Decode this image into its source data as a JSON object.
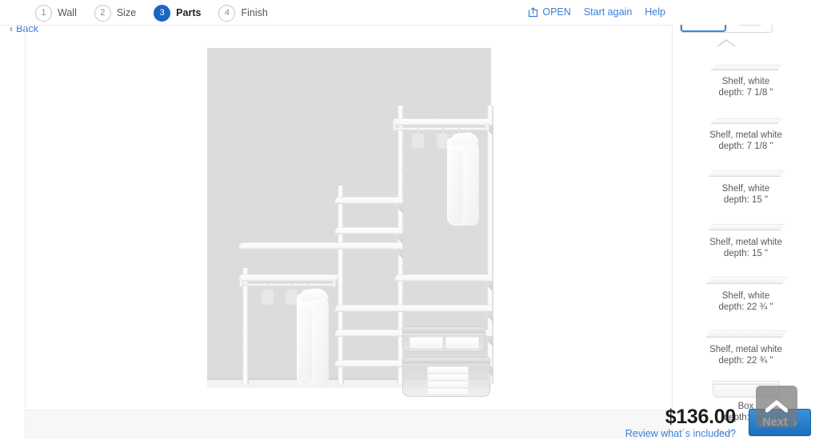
{
  "steps": [
    {
      "number": "1",
      "label": "Wall",
      "active": false
    },
    {
      "number": "2",
      "label": "Size",
      "active": false
    },
    {
      "number": "3",
      "label": "Parts",
      "active": true
    },
    {
      "number": "4",
      "label": "Finish",
      "active": false
    }
  ],
  "top_actions": {
    "open_label": "OPEN",
    "open_icon": "open-export-icon",
    "start_again_label": "Start again",
    "help_label": "Help"
  },
  "bottom": {
    "back_label": "Back",
    "back_chevron": "‹",
    "price": "$136.00",
    "review_label": "Review what´s included?",
    "next_label": "Next",
    "next_chevron": "›"
  },
  "sidebar": {
    "view_toggles": [
      {
        "name": "single-shelf-view",
        "selected": true
      },
      {
        "name": "stacked-shelves-view",
        "selected": false
      }
    ],
    "scroll_up_icon": "chevron-up-icon",
    "scroll_down_icon": "chevron-down-icon",
    "scroll_top_icon": "chevron-up-icon",
    "parts": [
      {
        "thumb": "shelf",
        "name": "Shelf, white",
        "depth": "depth: 7 1/8 \""
      },
      {
        "thumb": "shelf",
        "name": "Shelf, metal white",
        "depth": "depth: 7 1/8 \""
      },
      {
        "thumb": "shelf",
        "name": "Shelf, white",
        "depth": "depth: 15 \""
      },
      {
        "thumb": "shelf",
        "name": "Shelf, metal white",
        "depth": "depth: 15 \""
      },
      {
        "thumb": "shelf",
        "name": "Shelf, white",
        "depth": "depth: 22 ¾ \""
      },
      {
        "thumb": "shelf",
        "name": "Shelf, metal white",
        "depth": "depth: 22 ¾ \""
      },
      {
        "thumb": "box",
        "name": "Box",
        "depth": "depth: 15 \""
      }
    ]
  },
  "colors": {
    "accent_blue": "#1a66c4",
    "link_blue": "#3a7fd5",
    "button_blue": "#2c80cd",
    "wall_gray": "#dcdcdc",
    "bottom_bar": "#f7f7f7"
  }
}
